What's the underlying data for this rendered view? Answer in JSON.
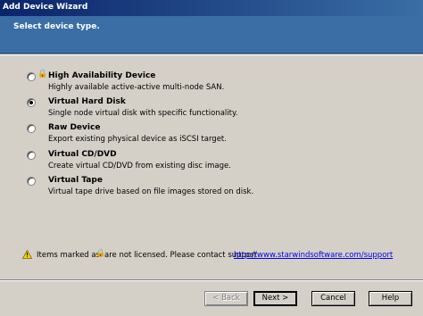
{
  "window": {
    "title": "Add Device Wizard"
  },
  "header": {
    "title": "Select device type."
  },
  "options": [
    {
      "label": "High Availability Device",
      "description": "Highly available active-active multi-node SAN.",
      "checked": false,
      "locked": true
    },
    {
      "label": "Virtual Hard Disk",
      "description": "Single node virtual disk with specific functionality.",
      "checked": true,
      "locked": false
    },
    {
      "label": "Raw Device",
      "description": "Export existing physical device as iSCSI target.",
      "checked": false,
      "locked": false
    },
    {
      "label": "Virtual CD/DVD",
      "description": "Create virtual CD/DVD from existing disc image.",
      "checked": false,
      "locked": false
    },
    {
      "label": "Virtual Tape",
      "description": "Virtual tape drive based on file images stored on disk.",
      "checked": false,
      "locked": false
    }
  ],
  "notice": {
    "prefix": "Items marked as",
    "suffix": "are not licensed. Please contact support",
    "link": "http://www.starwindsoftware.com/support",
    "icon": "warning-icon",
    "lock_icon": "lock-icon"
  },
  "buttons": {
    "back": "< Back",
    "next": "Next >",
    "cancel": "Cancel",
    "help": "Help"
  },
  "colors": {
    "header_blue": "#3a6ea5",
    "title_dark": "#0a246a",
    "window_bg": "#d4d0c8",
    "link": "#0000ee"
  }
}
